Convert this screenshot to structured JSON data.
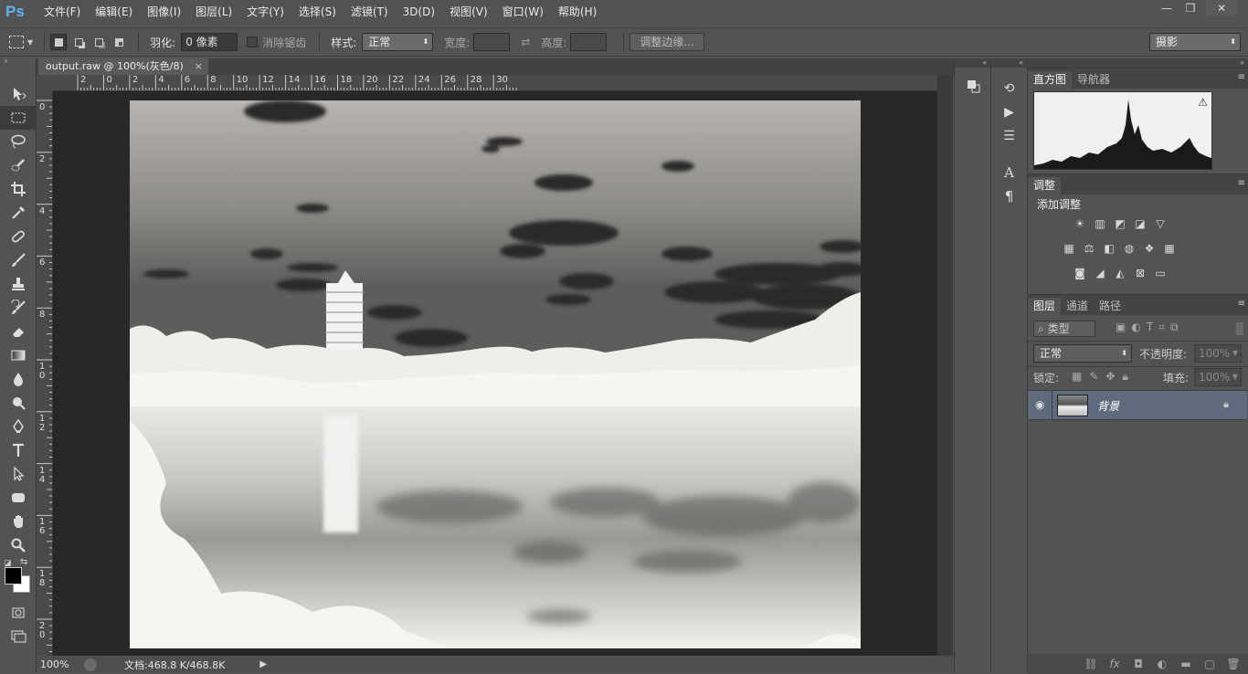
{
  "app": {
    "logo": "Ps"
  },
  "menu": [
    "文件(F)",
    "编辑(E)",
    "图像(I)",
    "图层(L)",
    "文字(Y)",
    "选择(S)",
    "滤镜(T)",
    "3D(D)",
    "视图(V)",
    "窗口(W)",
    "帮助(H)"
  ],
  "window_controls": {
    "minimize": "—",
    "restore": "❐",
    "close": "✕"
  },
  "options": {
    "feather_label": "羽化:",
    "feather_value": "0 像素",
    "antialias_label": "消除锯齿",
    "style_label": "样式:",
    "style_value": "正常",
    "width_label": "宽度:",
    "height_label": "高度:",
    "refine_edge": "调整边缘...",
    "workspace": "摄影"
  },
  "document": {
    "tab_title": "output.raw @ 100%(灰色/8)",
    "close": "×",
    "zoom": "100%",
    "doc_info": "文档:468.8 K/468.8K"
  },
  "ruler_h": [
    "2",
    "0",
    "2",
    "4",
    "6",
    "8",
    "10",
    "12",
    "14",
    "16",
    "18",
    "20",
    "22",
    "24",
    "26",
    "28",
    "30"
  ],
  "ruler_v": [
    "0",
    "2",
    "4",
    "6",
    "8",
    "1 0",
    "1 2",
    "1 4",
    "1 6",
    "1 8",
    "2 0"
  ],
  "histogram_panel": {
    "tabs": [
      "直方图",
      "导航器"
    ],
    "warning": "⚠"
  },
  "adjustments_panel": {
    "tab": "调整",
    "title": "添加调整"
  },
  "layers_panel": {
    "tabs": [
      "图层",
      "通道",
      "路径"
    ],
    "filter_kind": "类型",
    "blend_mode": "正常",
    "opacity_label": "不透明度:",
    "opacity_value": "100%",
    "lock_label": "锁定:",
    "fill_label": "填充:",
    "fill_value": "100%",
    "layers": [
      {
        "name": "背景",
        "visible": true,
        "locked": true
      }
    ]
  },
  "colors": {
    "accent_ps": "#5fb3f0",
    "selected_layer": "#5d6b7d",
    "ui_bg": "#535353",
    "canvas_bg": "#282828"
  }
}
